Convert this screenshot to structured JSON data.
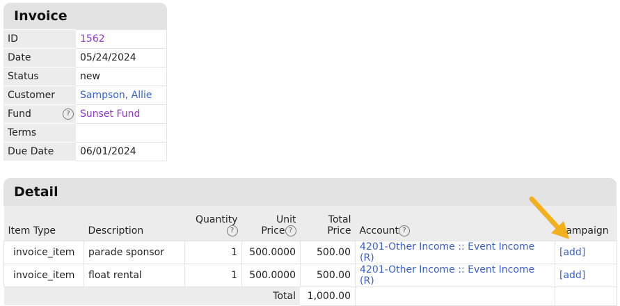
{
  "invoice": {
    "title": "Invoice",
    "fields": [
      {
        "label": "ID",
        "value": "1562"
      },
      {
        "label": "Date",
        "value": "05/24/2024"
      },
      {
        "label": "Status",
        "value": "new"
      },
      {
        "label": "Customer",
        "value": "Sampson, Allie"
      },
      {
        "label": "Fund",
        "value": "Sunset Fund"
      },
      {
        "label": "Terms",
        "value": ""
      },
      {
        "label": "Due Date",
        "value": "06/01/2024"
      }
    ],
    "help_glyph": "?"
  },
  "detail": {
    "title": "Detail",
    "headers": {
      "item_type": "Item Type",
      "description": "Description",
      "quantity": "Quantity",
      "unit_price_1": "Unit",
      "unit_price_2": "Price",
      "total_price_1": "Total",
      "total_price_2": "Price",
      "account": "Account",
      "campaign": "Campaign"
    },
    "rows": [
      {
        "item_type": "invoice_item",
        "description": "parade sponsor",
        "quantity": "1",
        "unit_price": "500.0000",
        "total_price": "500.00",
        "account": "4201-Other Income :: Event Income (R)",
        "campaign": "[add]"
      },
      {
        "item_type": "invoice_item",
        "description": "float rental",
        "quantity": "1",
        "unit_price": "500.0000",
        "total_price": "500.00",
        "account": "4201-Other Income :: Event Income (R)",
        "campaign": "[add]"
      }
    ],
    "total_label": "Total",
    "total_value": "1,000.00"
  },
  "colors": {
    "link": "#3a5fcd",
    "visited_link": "#8e35c9",
    "panel_header": "#e3e3e3",
    "arrow": "#f2b01e"
  }
}
